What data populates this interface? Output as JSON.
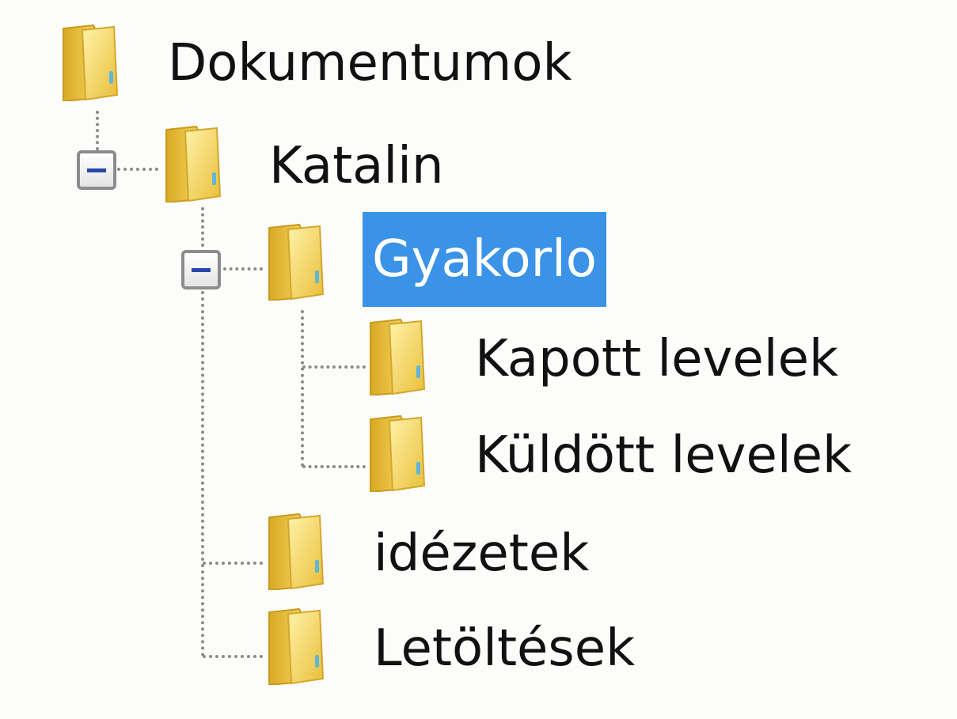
{
  "tree": {
    "root": {
      "label": "Dokumentumok",
      "icon": "folder-icon"
    },
    "katalin": {
      "label": "Katalin",
      "icon": "folder-icon",
      "expander": "collapse-icon"
    },
    "gyakorlo": {
      "label": "Gyakorlo",
      "icon": "folder-icon",
      "expander": "collapse-icon",
      "selected": true
    },
    "kapott": {
      "label": "Kapott levelek",
      "icon": "folder-icon"
    },
    "kuldott": {
      "label": "Küldött levelek",
      "icon": "folder-icon"
    },
    "idezetek": {
      "label": "idézetek",
      "icon": "folder-icon"
    },
    "letoltesek": {
      "label": "Letöltések",
      "icon": "folder-icon"
    }
  },
  "colors": {
    "background": "#fcfcfa",
    "selection": "#3a93e6",
    "folder": "#f2d45c",
    "expander_minus": "#2a46a8"
  }
}
